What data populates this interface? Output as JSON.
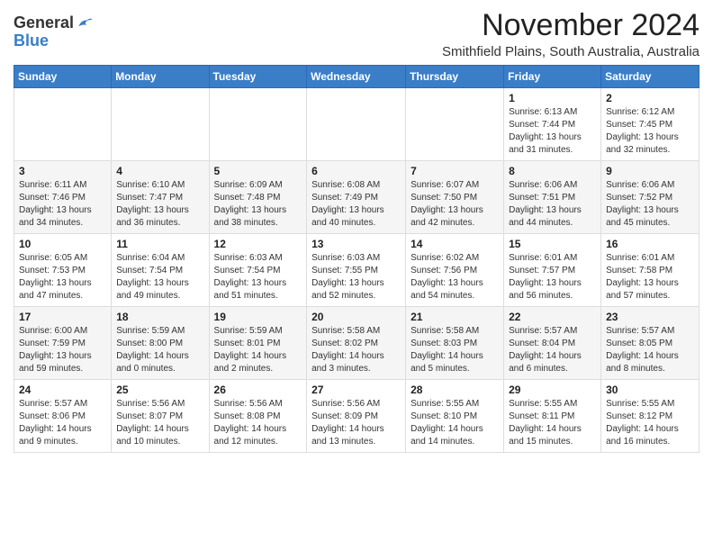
{
  "header": {
    "logo_general": "General",
    "logo_blue": "Blue",
    "month": "November 2024",
    "location": "Smithfield Plains, South Australia, Australia"
  },
  "weekdays": [
    "Sunday",
    "Monday",
    "Tuesday",
    "Wednesday",
    "Thursday",
    "Friday",
    "Saturday"
  ],
  "weeks": [
    [
      {
        "day": "",
        "info": ""
      },
      {
        "day": "",
        "info": ""
      },
      {
        "day": "",
        "info": ""
      },
      {
        "day": "",
        "info": ""
      },
      {
        "day": "",
        "info": ""
      },
      {
        "day": "1",
        "info": "Sunrise: 6:13 AM\nSunset: 7:44 PM\nDaylight: 13 hours\nand 31 minutes."
      },
      {
        "day": "2",
        "info": "Sunrise: 6:12 AM\nSunset: 7:45 PM\nDaylight: 13 hours\nand 32 minutes."
      }
    ],
    [
      {
        "day": "3",
        "info": "Sunrise: 6:11 AM\nSunset: 7:46 PM\nDaylight: 13 hours\nand 34 minutes."
      },
      {
        "day": "4",
        "info": "Sunrise: 6:10 AM\nSunset: 7:47 PM\nDaylight: 13 hours\nand 36 minutes."
      },
      {
        "day": "5",
        "info": "Sunrise: 6:09 AM\nSunset: 7:48 PM\nDaylight: 13 hours\nand 38 minutes."
      },
      {
        "day": "6",
        "info": "Sunrise: 6:08 AM\nSunset: 7:49 PM\nDaylight: 13 hours\nand 40 minutes."
      },
      {
        "day": "7",
        "info": "Sunrise: 6:07 AM\nSunset: 7:50 PM\nDaylight: 13 hours\nand 42 minutes."
      },
      {
        "day": "8",
        "info": "Sunrise: 6:06 AM\nSunset: 7:51 PM\nDaylight: 13 hours\nand 44 minutes."
      },
      {
        "day": "9",
        "info": "Sunrise: 6:06 AM\nSunset: 7:52 PM\nDaylight: 13 hours\nand 45 minutes."
      }
    ],
    [
      {
        "day": "10",
        "info": "Sunrise: 6:05 AM\nSunset: 7:53 PM\nDaylight: 13 hours\nand 47 minutes."
      },
      {
        "day": "11",
        "info": "Sunrise: 6:04 AM\nSunset: 7:54 PM\nDaylight: 13 hours\nand 49 minutes."
      },
      {
        "day": "12",
        "info": "Sunrise: 6:03 AM\nSunset: 7:54 PM\nDaylight: 13 hours\nand 51 minutes."
      },
      {
        "day": "13",
        "info": "Sunrise: 6:03 AM\nSunset: 7:55 PM\nDaylight: 13 hours\nand 52 minutes."
      },
      {
        "day": "14",
        "info": "Sunrise: 6:02 AM\nSunset: 7:56 PM\nDaylight: 13 hours\nand 54 minutes."
      },
      {
        "day": "15",
        "info": "Sunrise: 6:01 AM\nSunset: 7:57 PM\nDaylight: 13 hours\nand 56 minutes."
      },
      {
        "day": "16",
        "info": "Sunrise: 6:01 AM\nSunset: 7:58 PM\nDaylight: 13 hours\nand 57 minutes."
      }
    ],
    [
      {
        "day": "17",
        "info": "Sunrise: 6:00 AM\nSunset: 7:59 PM\nDaylight: 13 hours\nand 59 minutes."
      },
      {
        "day": "18",
        "info": "Sunrise: 5:59 AM\nSunset: 8:00 PM\nDaylight: 14 hours\nand 0 minutes."
      },
      {
        "day": "19",
        "info": "Sunrise: 5:59 AM\nSunset: 8:01 PM\nDaylight: 14 hours\nand 2 minutes."
      },
      {
        "day": "20",
        "info": "Sunrise: 5:58 AM\nSunset: 8:02 PM\nDaylight: 14 hours\nand 3 minutes."
      },
      {
        "day": "21",
        "info": "Sunrise: 5:58 AM\nSunset: 8:03 PM\nDaylight: 14 hours\nand 5 minutes."
      },
      {
        "day": "22",
        "info": "Sunrise: 5:57 AM\nSunset: 8:04 PM\nDaylight: 14 hours\nand 6 minutes."
      },
      {
        "day": "23",
        "info": "Sunrise: 5:57 AM\nSunset: 8:05 PM\nDaylight: 14 hours\nand 8 minutes."
      }
    ],
    [
      {
        "day": "24",
        "info": "Sunrise: 5:57 AM\nSunset: 8:06 PM\nDaylight: 14 hours\nand 9 minutes."
      },
      {
        "day": "25",
        "info": "Sunrise: 5:56 AM\nSunset: 8:07 PM\nDaylight: 14 hours\nand 10 minutes."
      },
      {
        "day": "26",
        "info": "Sunrise: 5:56 AM\nSunset: 8:08 PM\nDaylight: 14 hours\nand 12 minutes."
      },
      {
        "day": "27",
        "info": "Sunrise: 5:56 AM\nSunset: 8:09 PM\nDaylight: 14 hours\nand 13 minutes."
      },
      {
        "day": "28",
        "info": "Sunrise: 5:55 AM\nSunset: 8:10 PM\nDaylight: 14 hours\nand 14 minutes."
      },
      {
        "day": "29",
        "info": "Sunrise: 5:55 AM\nSunset: 8:11 PM\nDaylight: 14 hours\nand 15 minutes."
      },
      {
        "day": "30",
        "info": "Sunrise: 5:55 AM\nSunset: 8:12 PM\nDaylight: 14 hours\nand 16 minutes."
      }
    ]
  ]
}
